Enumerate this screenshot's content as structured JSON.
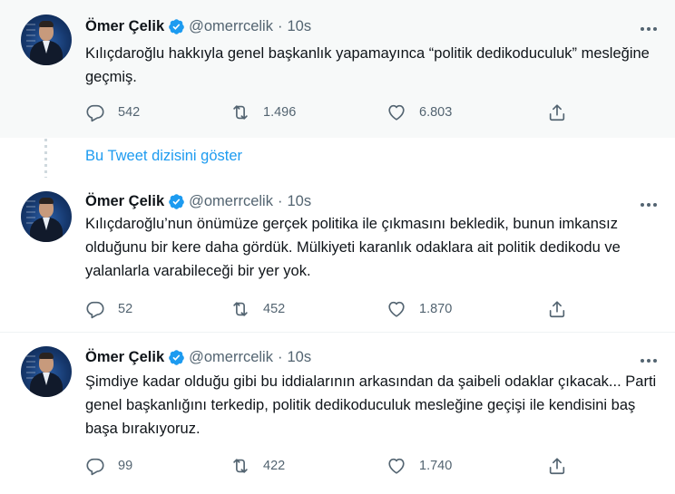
{
  "tweets": [
    {
      "name": "Ömer Çelik",
      "handle": "@omerrcelik",
      "separator": "·",
      "time": "10s",
      "text": "Kılıçdaroğlu hakkıyla genel başkanlık yapamayınca “politik dedikoduculuk” mesleğine geçmiş.",
      "replies": "542",
      "retweets": "1.496",
      "likes": "6.803"
    },
    {
      "name": "Ömer Çelik",
      "handle": "@omerrcelik",
      "separator": "·",
      "time": "10s",
      "text": "Kılıçdaroğlu’nun önümüze gerçek politika ile çıkmasını bekledik, bunun imkansız olduğunu bir kere daha gördük. Mülkiyeti karanlık odaklara ait politik dedikodu ve yalanlarla varabileceği bir yer yok.",
      "replies": "52",
      "retweets": "452",
      "likes": "1.870"
    },
    {
      "name": "Ömer Çelik",
      "handle": "@omerrcelik",
      "separator": "·",
      "time": "10s",
      "text": "Şimdiye kadar olduğu gibi bu iddialarının arkasından da şaibeli odaklar çıkacak... Parti genel başkanlığını terkedip, politik dedikoduculuk mesleğine geçişi ile kendisini baş başa bırakıyoruz.",
      "replies": "99",
      "retweets": "422",
      "likes": "1.740"
    }
  ],
  "show_thread_label": "Bu Tweet dizisini göster",
  "icons": {
    "verified": "verified-badge-icon",
    "more": "more-icon",
    "reply": "reply-icon",
    "retweet": "retweet-icon",
    "like": "like-icon",
    "share": "share-icon"
  },
  "colors": {
    "accent": "#1d9bf0",
    "secondary_text": "#536471",
    "primary_text": "#0f1419",
    "highlight_bg": "#f7f9f9"
  }
}
